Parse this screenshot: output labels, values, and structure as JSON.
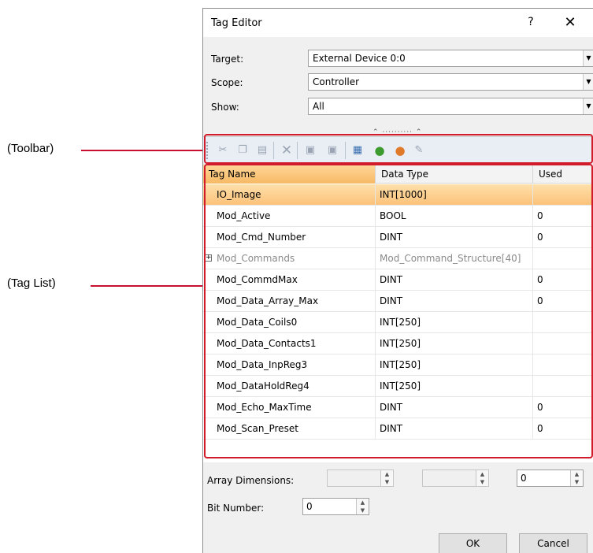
{
  "annotations": {
    "toolbar_label": "(Toolbar)",
    "taglist_label": "(Tag List)",
    "accent_color": "#d11a2a"
  },
  "dialog": {
    "title": "Tag Editor",
    "help_label": "?",
    "close_label": "✕",
    "target": {
      "label": "Target:",
      "value": "External Device 0:0"
    },
    "scope": {
      "label": "Scope:",
      "value": "Controller"
    },
    "show": {
      "label": "Show:",
      "value": "All"
    },
    "splitter": "⌃ ·········· ⌃"
  },
  "toolbar": {
    "icons": [
      "cut-icon",
      "copy-icon",
      "paste-icon",
      "delete-icon",
      "new-tag-icon",
      "edit-tag-icon",
      "import-icon",
      "refresh-icon",
      "add-tag-icon",
      "clear-icon"
    ]
  },
  "grid": {
    "headers": {
      "name": "Tag Name",
      "type": "Data Type",
      "used": "Used"
    },
    "rows": [
      {
        "name": "IO_Image",
        "type": "INT[1000]",
        "used": ""
      },
      {
        "name": "Mod_Active",
        "type": "BOOL",
        "used": "0"
      },
      {
        "name": "Mod_Cmd_Number",
        "type": "DINT",
        "used": "0"
      },
      {
        "name": "Mod_Commands",
        "type": "Mod_Command_Structure[40]",
        "used": ""
      },
      {
        "name": "Mod_CommdMax",
        "type": "DINT",
        "used": "0"
      },
      {
        "name": "Mod_Data_Array_Max",
        "type": "DINT",
        "used": "0"
      },
      {
        "name": "Mod_Data_Coils0",
        "type": "INT[250]",
        "used": ""
      },
      {
        "name": "Mod_Data_Contacts1",
        "type": "INT[250]",
        "used": ""
      },
      {
        "name": "Mod_Data_InpReg3",
        "type": "INT[250]",
        "used": ""
      },
      {
        "name": "Mod_DataHoldReg4",
        "type": "INT[250]",
        "used": ""
      },
      {
        "name": "Mod_Echo_MaxTime",
        "type": "DINT",
        "used": "0"
      },
      {
        "name": "Mod_Scan_Preset",
        "type": "DINT",
        "used": "0"
      }
    ],
    "expander_symbol": "+"
  },
  "bottom": {
    "array_dimensions_label": "Array Dimensions:",
    "array_dim3_value": "0",
    "bit_number_label": "Bit Number:",
    "bit_number_value": "0",
    "ok_label": "OK",
    "cancel_label": "Cancel"
  }
}
